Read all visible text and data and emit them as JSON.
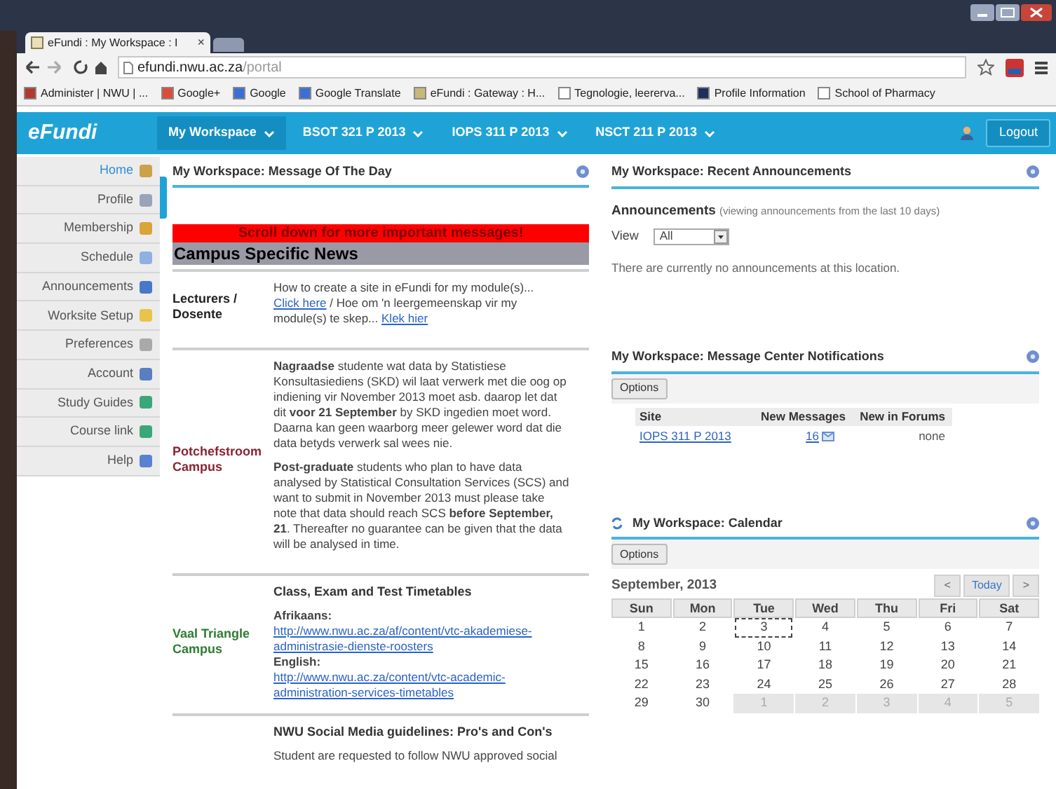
{
  "browser": {
    "tab": {
      "title": "eFundi : My Workspace : I",
      "close": "×"
    },
    "address": {
      "host": "efundi.nwu.ac.za",
      "path": "/portal"
    },
    "bookmarks": [
      {
        "label": "Administer | NWU | ..."
      },
      {
        "label": "Google+"
      },
      {
        "label": "Google"
      },
      {
        "label": "Google Translate"
      },
      {
        "label": "eFundi : Gateway : H..."
      },
      {
        "label": "Tegnologie, leererva..."
      },
      {
        "label": "Profile Information"
      },
      {
        "label": "School of Pharmacy"
      }
    ]
  },
  "nav": {
    "logo": "eFundi",
    "tabs": [
      {
        "label": "My Workspace",
        "selected": true
      },
      {
        "label": "BSOT 321 P 2013",
        "selected": false
      },
      {
        "label": "IOPS 311 P 2013",
        "selected": false
      },
      {
        "label": "NSCT 211 P 2013",
        "selected": false
      }
    ],
    "logout": "Logout"
  },
  "sidebar": {
    "items": [
      {
        "label": "Home",
        "selected": true
      },
      {
        "label": "Profile",
        "selected": false
      },
      {
        "label": "Membership",
        "selected": false
      },
      {
        "label": "Schedule",
        "selected": false
      },
      {
        "label": "Announcements",
        "selected": false
      },
      {
        "label": "Worksite Setup",
        "selected": false
      },
      {
        "label": "Preferences",
        "selected": false
      },
      {
        "label": "Account",
        "selected": false
      },
      {
        "label": "Study Guides",
        "selected": false
      },
      {
        "label": "Course link",
        "selected": false
      },
      {
        "label": "Help",
        "selected": false
      }
    ]
  },
  "motd": {
    "title": "My Workspace: Message Of The Day",
    "banner": "Scroll down for more important messages!",
    "heading": "Campus Specific News",
    "sections": [
      {
        "campus": "Lecturers / Dosente",
        "color": "#222222",
        "blocks": [
          {
            "kind": "paragraph",
            "segments": [
              {
                "kind": "text",
                "text": "How to create a site in eFundi for my module(s)..."
              },
              {
                "kind": "link",
                "text": "Click here"
              },
              {
                "kind": "text",
                "text": "/ Hoe om 'n leergemeenskap vir my module(s) te skep..."
              },
              {
                "kind": "link",
                "text": "Klek hier"
              }
            ]
          }
        ]
      },
      {
        "campus": "Potchefstroom Campus",
        "color": "#8b2332",
        "blocks": [
          {
            "kind": "paragraph",
            "segments": [
              {
                "kind": "text",
                "text": "**Nagraadse** studente wat data by Statistiese Konsultasiediens (SKD) wil laat verwerk met die oog op indiening vir November 2013 moet asb. daarop let dat dit **voor 21 September** by SKD ingedien moet word. Daarna kan geen waarborg meer gelewer word dat die data betyds verwerk sal wees nie."
              }
            ]
          },
          {
            "kind": "paragraph",
            "segments": [
              {
                "kind": "text",
                "text": "**Post-graduate** students who plan to have data analysed by Statistical Consultation Services (SCS) and want to submit in November 2013 must please take note that data should reach SCS **before September, 21**. Thereafter no guarantee can be given that the data will be analysed in time."
              }
            ]
          }
        ]
      },
      {
        "campus": "Vaal Triangle Campus",
        "color": "#2e7d32",
        "blocks": [
          {
            "kind": "heading",
            "segments": [
              {
                "kind": "text",
                "text": "Class, Exam and Test Timetables"
              }
            ]
          },
          {
            "kind": "line",
            "segments": [
              {
                "kind": "text",
                "text": "**Afrikaans:**"
              },
              {
                "kind": "link",
                "text": "http://www.nwu.ac.za/af/content/vtc-akademiese-administrasie-dienste-roosters"
              }
            ]
          },
          {
            "kind": "line",
            "segments": [
              {
                "kind": "text",
                "text": "**English:**"
              },
              {
                "kind": "link",
                "text": "http://www.nwu.ac.za/content/vtc-academic-administration-services-timetables"
              }
            ]
          }
        ]
      },
      {
        "blocks": [
          {
            "kind": "heading",
            "segments": [
              {
                "kind": "text",
                "text": "NWU Social Media guidelines: Pro's and Con's"
              }
            ]
          },
          {
            "kind": "paragraph",
            "segments": [
              {
                "kind": "text",
                "text": "Student are requested to follow NWU approved social"
              }
            ]
          }
        ]
      }
    ]
  },
  "announcements": {
    "title": "My Workspace: Recent Announcements",
    "label": "Announcements",
    "note": "(viewing announcements from the last 10 days)",
    "view_label": "View",
    "view_value": "All",
    "empty": "There are currently no announcements at this location."
  },
  "messages": {
    "title": "My Workspace: Message Center Notifications",
    "options": "Options",
    "columns": [
      "Site",
      "New Messages",
      "New in Forums"
    ],
    "rows": [
      {
        "site": "IOPS 311 P 2013",
        "new_messages": "16",
        "new_in_forums": "none"
      }
    ]
  },
  "calendar": {
    "title": "My Workspace: Calendar",
    "options": "Options",
    "month": "September, 2013",
    "prev": "<",
    "today": "Today",
    "next": ">",
    "weekdays": [
      "Sun",
      "Mon",
      "Tue",
      "Wed",
      "Thu",
      "Fri",
      "Sat"
    ],
    "weeks": [
      [
        {
          "day": "1",
          "today": false,
          "outside": false
        },
        {
          "day": "2",
          "today": false,
          "outside": false
        },
        {
          "day": "3",
          "today": true,
          "outside": false
        },
        {
          "day": "4",
          "today": false,
          "outside": false
        },
        {
          "day": "5",
          "today": false,
          "outside": false
        },
        {
          "day": "6",
          "today": false,
          "outside": false
        },
        {
          "day": "7",
          "today": false,
          "outside": false
        }
      ],
      [
        {
          "day": "8",
          "today": false,
          "outside": false
        },
        {
          "day": "9",
          "today": false,
          "outside": false
        },
        {
          "day": "10",
          "today": false,
          "outside": false
        },
        {
          "day": "11",
          "today": false,
          "outside": false
        },
        {
          "day": "12",
          "today": false,
          "outside": false
        },
        {
          "day": "13",
          "today": false,
          "outside": false
        },
        {
          "day": "14",
          "today": false,
          "outside": false
        }
      ],
      [
        {
          "day": "15",
          "today": false,
          "outside": false
        },
        {
          "day": "16",
          "today": false,
          "outside": false
        },
        {
          "day": "17",
          "today": false,
          "outside": false
        },
        {
          "day": "18",
          "today": false,
          "outside": false
        },
        {
          "day": "19",
          "today": false,
          "outside": false
        },
        {
          "day": "20",
          "today": false,
          "outside": false
        },
        {
          "day": "21",
          "today": false,
          "outside": false
        }
      ],
      [
        {
          "day": "22",
          "today": false,
          "outside": false
        },
        {
          "day": "23",
          "today": false,
          "outside": false
        },
        {
          "day": "24",
          "today": false,
          "outside": false
        },
        {
          "day": "25",
          "today": false,
          "outside": false
        },
        {
          "day": "26",
          "today": false,
          "outside": false
        },
        {
          "day": "27",
          "today": false,
          "outside": false
        },
        {
          "day": "28",
          "today": false,
          "outside": false
        }
      ],
      [
        {
          "day": "29",
          "today": false,
          "outside": false
        },
        {
          "day": "30",
          "today": false,
          "outside": false
        },
        {
          "day": "1",
          "today": false,
          "outside": true
        },
        {
          "day": "2",
          "today": false,
          "outside": true
        },
        {
          "day": "3",
          "today": false,
          "outside": true
        },
        {
          "day": "4",
          "today": false,
          "outside": true
        },
        {
          "day": "5",
          "today": false,
          "outside": true
        }
      ]
    ]
  }
}
